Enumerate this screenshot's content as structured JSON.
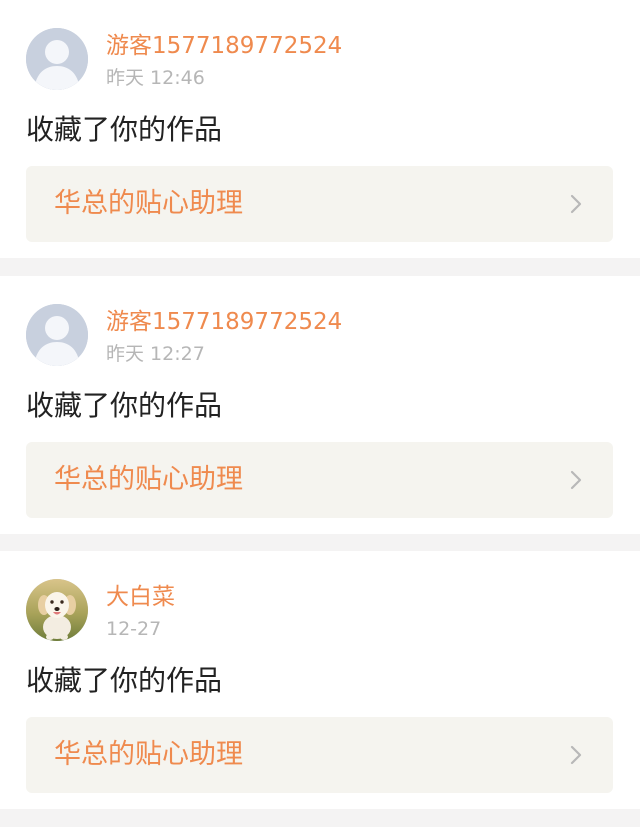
{
  "notifications": [
    {
      "avatar_icon": "default-user-icon",
      "username": "游客1577189772524",
      "time": "昨天 12:46",
      "message": "收藏了你的作品",
      "work_title": "华总的贴心助理",
      "chevron_icon": "chevron-right-icon"
    },
    {
      "avatar_icon": "default-user-icon",
      "username": "游客1577189772524",
      "time": "昨天 12:27",
      "message": "收藏了你的作品",
      "work_title": "华总的贴心助理",
      "chevron_icon": "chevron-right-icon"
    },
    {
      "avatar_icon": "dog-photo-avatar",
      "username": "大白菜",
      "time": "12-27",
      "message": "收藏了你的作品",
      "work_title": "华总的贴心助理",
      "chevron_icon": "chevron-right-icon"
    }
  ],
  "colors": {
    "accent": "#ef8a4e",
    "card_background": "#ffffff",
    "separator": "#f4f3f3",
    "link_background": "#f5f4ef",
    "time_text": "#b6b6b6"
  }
}
